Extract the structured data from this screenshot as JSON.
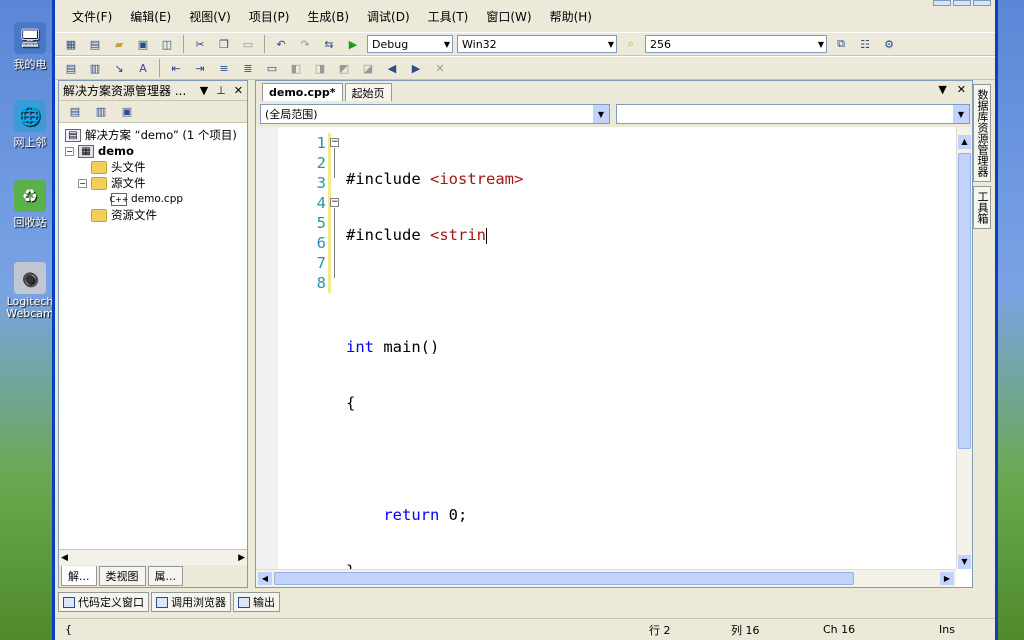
{
  "desktop": {
    "icons": [
      {
        "label": "我的电",
        "icon": "computer-icon"
      },
      {
        "label": "网上邻",
        "icon": "network-icon"
      },
      {
        "label": "回收站",
        "icon": "recycle-bin-icon"
      },
      {
        "label": "Logitech Webcam",
        "icon": "webcam-icon"
      }
    ]
  },
  "menubar": {
    "items": [
      "文件(F)",
      "编辑(E)",
      "视图(V)",
      "项目(P)",
      "生成(B)",
      "调试(D)",
      "工具(T)",
      "窗口(W)",
      "帮助(H)"
    ]
  },
  "toolbar": {
    "config": "Debug",
    "platform": "Win32",
    "find_value": "256"
  },
  "solution_explorer": {
    "title": "解决方案资源管理器 ...",
    "solution_label": "解决方案 “demo” (1 个项目)",
    "project": "demo",
    "folders": {
      "headers": "头文件",
      "sources": "源文件",
      "resources": "资源文件"
    },
    "file": "demo.cpp",
    "tabs": [
      "解...",
      "类视图",
      "属..."
    ]
  },
  "editor": {
    "tabs": {
      "active": "demo.cpp*",
      "start_page": "起始页"
    },
    "scope": "(全局范围)",
    "members": "",
    "line_numbers": [
      "1",
      "2",
      "3",
      "4",
      "5",
      "6",
      "7",
      "8"
    ],
    "code": {
      "l1_directive": "#include",
      "l1_header": "<iostream>",
      "l2_directive": "#include",
      "l2_partial": "<strin",
      "l4_type": "int",
      "l4_rest": " main()",
      "l5": "{",
      "l7_kw": "return",
      "l7_rest": " 0;",
      "l8": "}"
    }
  },
  "right_tabs": [
    "数据库资源管理器",
    "工具箱"
  ],
  "bottom_tabs": [
    "代码定义窗口",
    "调用浏览器",
    "输出"
  ],
  "statusbar": {
    "left": "{",
    "line": "行 2",
    "col": "列 16",
    "ch": "Ch 16",
    "mode": "Ins"
  },
  "colors": {
    "keyword": "#0000ff",
    "string": "#a31515",
    "line_number": "#2b91af",
    "title_blue": "#0a3fbf"
  }
}
